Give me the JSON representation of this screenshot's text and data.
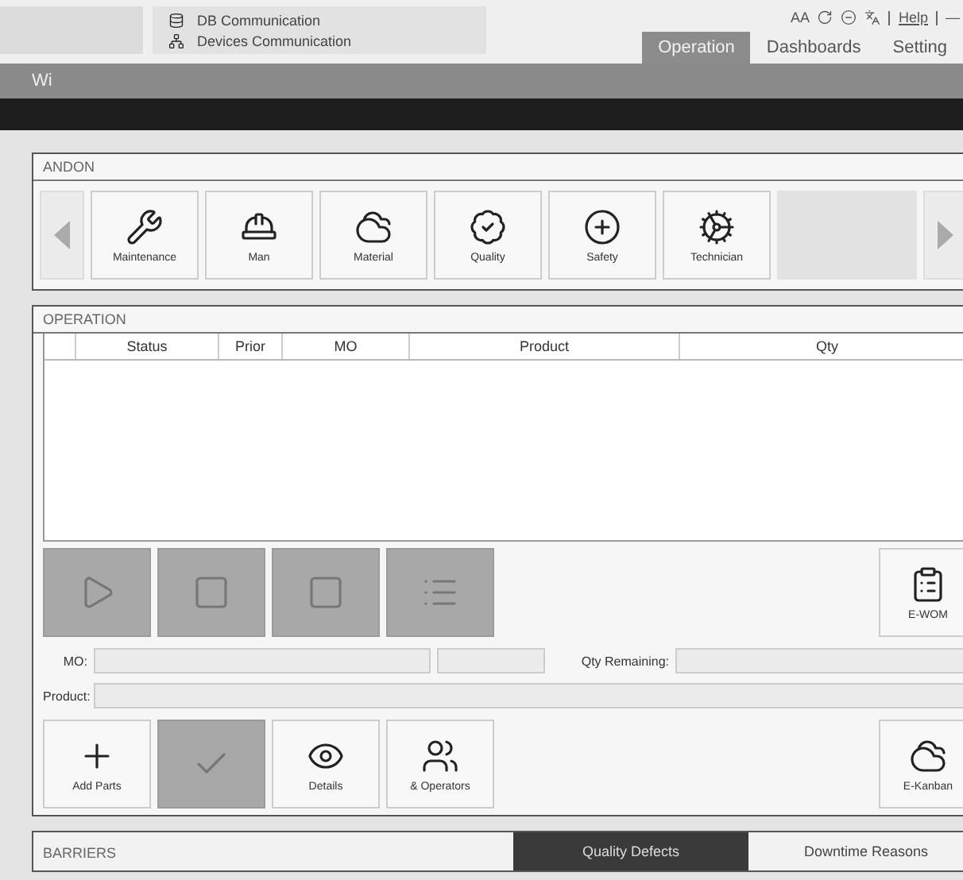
{
  "header": {
    "links": [
      {
        "label": "DB Communication",
        "kind": "db"
      },
      {
        "label": "Devices Communication",
        "kind": "devices"
      }
    ],
    "tools": [
      {
        "kind": "text",
        "label": "AA"
      },
      {
        "kind": "refresh"
      },
      {
        "kind": "minus"
      },
      {
        "kind": "translate"
      },
      {
        "kind": "link",
        "label": "Help"
      },
      {
        "kind": "text",
        "label": "—"
      }
    ],
    "tabs": [
      {
        "label": "Operation",
        "selected": true
      },
      {
        "label": "Dashboards",
        "selected": false
      },
      {
        "label": "Setting",
        "selected": false
      }
    ]
  },
  "bar_title": "Wi",
  "andon": {
    "title": "ANDON",
    "buttons": [
      {
        "kind": "maintenance",
        "label": "Maintenance"
      },
      {
        "kind": "man",
        "label": "Man"
      },
      {
        "kind": "material",
        "label": "Material"
      },
      {
        "kind": "quality",
        "label": "Quality"
      },
      {
        "kind": "safety",
        "label": "Safety"
      },
      {
        "kind": "technician",
        "label": "Technician"
      }
    ]
  },
  "operation": {
    "title": "OPERATION",
    "columns": [
      "Status",
      "Prior",
      "MO",
      "Product",
      "Qty"
    ],
    "actions": [
      {
        "kind": "play",
        "disabled": true
      },
      {
        "kind": "square",
        "disabled": true
      },
      {
        "kind": "square",
        "disabled": true
      },
      {
        "kind": "list",
        "disabled": true
      }
    ],
    "ewom": {
      "kind": "clipboard",
      "label": "E-WOM"
    },
    "mo_label": "MO:",
    "qty_label": "Qty Remaining:",
    "product_label": "Product:",
    "bottom": [
      {
        "kind": "plus",
        "label": "Add Parts",
        "disabled": false
      },
      {
        "kind": "check",
        "disabled": true
      },
      {
        "kind": "eye",
        "label": "Details",
        "disabled": false
      },
      {
        "kind": "men",
        "label": "& Operators",
        "disabled": false
      }
    ],
    "kanban": {
      "kind": "material",
      "label": "E-Kanban"
    }
  },
  "barriers": {
    "title": "BARRIERS",
    "tabs": [
      {
        "label": "Quality Defects",
        "selected": true
      },
      {
        "label": "Downtime Reasons",
        "selected": false
      }
    ]
  }
}
